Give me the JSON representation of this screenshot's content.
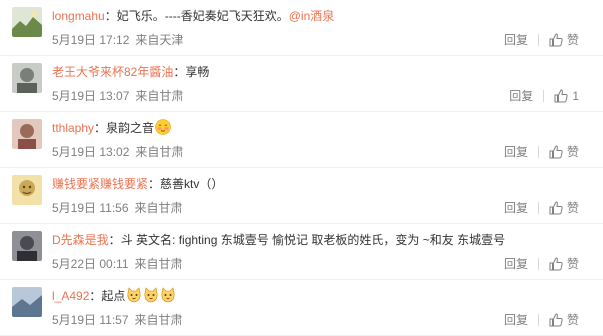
{
  "comments": [
    {
      "user": "longmahu",
      "colon": "：",
      "text": "妃飞乐。----香妃奏妃飞天狂欢。",
      "mention": "@in酒泉",
      "date": "5月19日 17:12",
      "source": "来自天津",
      "reply": "回复",
      "like": "赞",
      "avatar_color": "#6b8a4a"
    },
    {
      "user": "老王大爷来杯82年醬油",
      "colon": "：",
      "text": "享畅",
      "date": "5月19日 13:07",
      "source": "来自甘肃",
      "reply": "回复",
      "like": "1",
      "avatar_color": "#7a7f7a"
    },
    {
      "user": "tthlaphy",
      "colon": "：",
      "text": "泉韵之音",
      "emoji": "shy-face-emoji",
      "date": "5月19日 13:02",
      "source": "来自甘肃",
      "reply": "回复",
      "like": "赞",
      "avatar_color": "#9a6b5a"
    },
    {
      "user": "赚钱要紧赚钱要紧",
      "colon": "：",
      "text": "慈善ktv（）",
      "date": "5月19日 11:56",
      "source": "来自甘肃",
      "reply": "回复",
      "like": "赞",
      "avatar_color": "#c9a85a"
    },
    {
      "user": "D先森是我",
      "colon": "：",
      "text": "斗 英文名: fighting 东城壹号 愉悦记 取老板的姓氏，变为 ~和友 东城壹号",
      "date": "5月22日 00:11",
      "source": "来自甘肃",
      "reply": "回复",
      "like": "赞",
      "avatar_color": "#4a4a52"
    },
    {
      "user": "l_A492",
      "colon": "：",
      "text": "起点",
      "emoji_count": 3,
      "emoji": "cat-face-emoji",
      "date": "5月19日 11:57",
      "source": "来自甘肃",
      "reply": "回复",
      "like": "赞",
      "avatar_color": "#5f7690"
    }
  ],
  "colors": {
    "username": "#eb7350",
    "meta": "#808080",
    "text": "#333333"
  }
}
